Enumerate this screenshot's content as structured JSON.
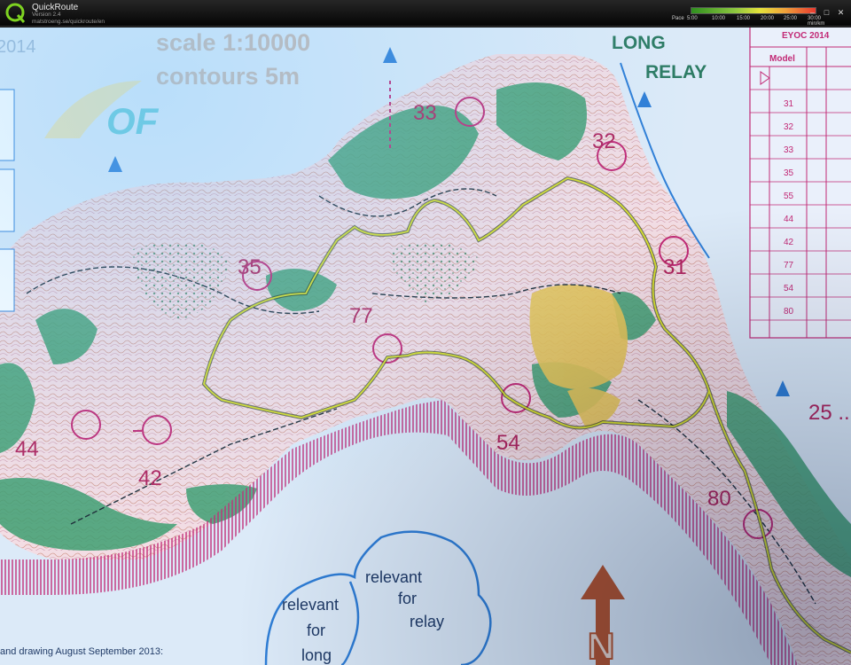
{
  "app": {
    "name": "QuickRoute",
    "version": "Version 2.4",
    "url": "matstroeng.se/quickroute/en"
  },
  "pace_legend": {
    "label": "Pace",
    "ticks": [
      "5:00",
      "10:00",
      "15:00",
      "20:00",
      "25:00",
      "30:00 min/km"
    ],
    "gradient_colors": [
      "#2f8f1f",
      "#8cc63f",
      "#e4e23a",
      "#f0a33a",
      "#e8392f"
    ]
  },
  "window_controls": [
    "minimize",
    "maximize",
    "close"
  ],
  "map": {
    "scale_text": "scale 1:10000",
    "contours_text": "contours 5m",
    "year_fragment": "2014",
    "event_title_line1": "LONG",
    "event_title_line2": "RELAY",
    "logo_text": "OF",
    "control_numbers": [
      "33",
      "32",
      "35",
      "77",
      "31",
      "54",
      "44",
      "42",
      "80",
      "25 ..."
    ],
    "table": {
      "header_title": "EYOC 2014",
      "column_header": "Model",
      "rows": [
        "31",
        "32",
        "33",
        "35",
        "55",
        "44",
        "42",
        "77",
        "54",
        "80"
      ]
    },
    "area_labels": {
      "relay_line1": "relevant",
      "relay_line2": "for",
      "relay_line3": "relay",
      "long_line1": "relevant",
      "long_line2": "for",
      "long_line3": "long"
    },
    "footer_text": "and drawing August September 2013:",
    "north_letter": "N",
    "colors": {
      "paper": "#dceaf8",
      "forest": "#3f9f72",
      "open_land": "#e8c65a",
      "contour": "#c98a7a",
      "purple": "#c22a76",
      "route": "#d9e02a",
      "water": "#2f7ed6"
    }
  }
}
